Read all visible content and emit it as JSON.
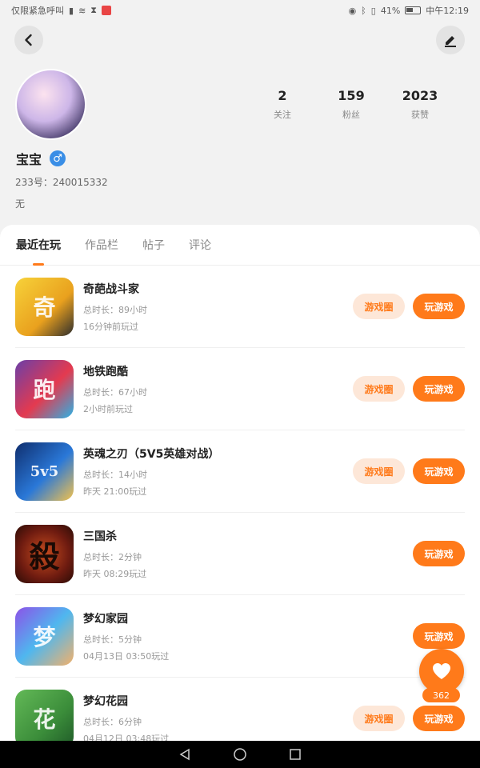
{
  "status_bar": {
    "left_text": "仅限紧急呼叫",
    "battery": "41%",
    "time": "中午12:19"
  },
  "header": {
    "back_icon": "back-arrow-icon",
    "edit_icon": "edit-icon"
  },
  "profile": {
    "nickname": "宝宝",
    "gender_symbol": "♂",
    "uid_line": "233号：240015332",
    "bio": "无",
    "stats": [
      {
        "value": "2",
        "label": "关注"
      },
      {
        "value": "159",
        "label": "粉丝"
      },
      {
        "value": "2023",
        "label": "获赞"
      }
    ]
  },
  "tabs": [
    {
      "label": "最近在玩",
      "active": true
    },
    {
      "label": "作品栏",
      "active": false
    },
    {
      "label": "帖子",
      "active": false
    },
    {
      "label": "评论",
      "active": false
    }
  ],
  "games": [
    {
      "name": "奇葩战斗家",
      "total": "总时长：89小时",
      "last": "16分钟前玩过",
      "circle": "游戏圈",
      "play": "玩游戏"
    },
    {
      "name": "地铁跑酷",
      "total": "总时长：67小时",
      "last": "2小时前玩过",
      "circle": "游戏圈",
      "play": "玩游戏"
    },
    {
      "name": "英魂之刃（5V5英雄对战）",
      "total": "总时长：14小时",
      "last": "昨天 21:00玩过",
      "circle": "游戏圈",
      "play": "玩游戏"
    },
    {
      "name": "三国杀",
      "total": "总时长：2分钟",
      "last": "昨天 08:29玩过",
      "play": "玩游戏"
    },
    {
      "name": "梦幻家园",
      "total": "总时长：5分钟",
      "last": "04月13日 03:50玩过",
      "play": "玩游戏"
    },
    {
      "name": "梦幻花园",
      "total": "总时长：6分钟",
      "last": "04月12日 03:48玩过",
      "circle": "游戏圈",
      "play": "玩游戏"
    }
  ],
  "icons": {
    "g1": "奇",
    "g2": "跑",
    "g3": "5v5",
    "g4": "殺",
    "g5": "梦",
    "g6": "花"
  },
  "like": {
    "count": "362"
  },
  "colors": {
    "accent": "#ff7a1a",
    "accent_light": "#fde7d8",
    "gender_blue": "#3a8ee6"
  }
}
